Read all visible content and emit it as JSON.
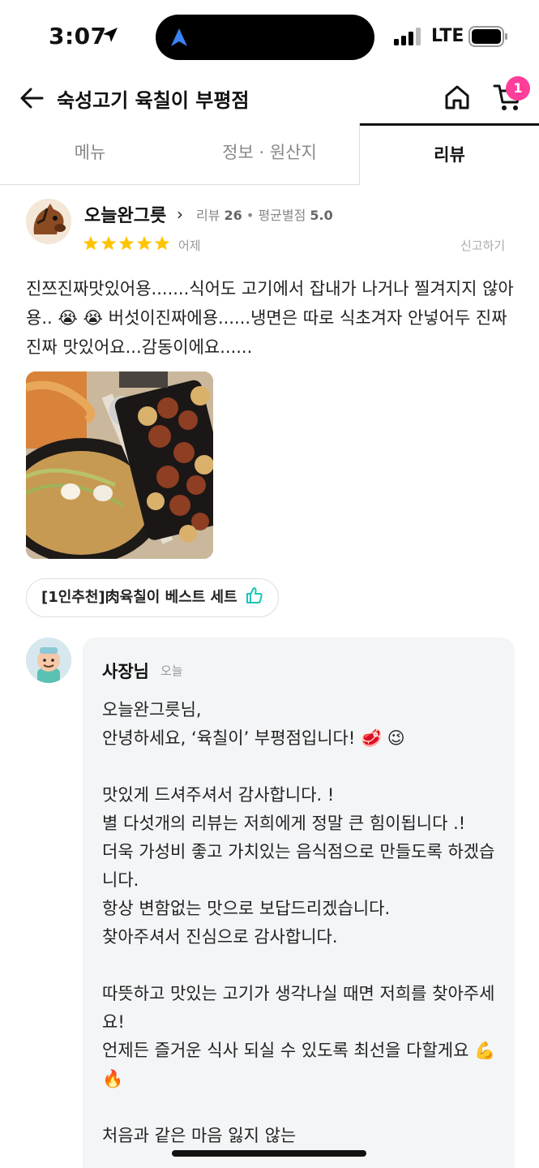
{
  "status_bar": {
    "time": "3:07",
    "network": "LTE"
  },
  "header": {
    "title": "숙성고기 육칠이 부평점",
    "cart_count": "1"
  },
  "tabs": [
    {
      "label": "메뉴"
    },
    {
      "label": "정보 · 원산지"
    },
    {
      "label": "리뷰"
    }
  ],
  "review": {
    "reviewer_name": "오늘완그릇",
    "review_count_label": "리뷰",
    "review_count": "26",
    "avg_rating_label": "평균별점",
    "avg_rating": "5.0",
    "rating": 5,
    "date": "어제",
    "report_label": "신고하기",
    "text": "진쯔진짜맛있어용.......식어도 고기에서 잡내가 나거나 찔겨지지 않아용.. 😭 😭 버섯이진짜에용......냉면은 따로 식초겨자 안넣어두 진짜진짜 맛있어요...감동이에요......",
    "menu_tag": "[1인추천]肉육칠이 베스트 세트"
  },
  "owner_reply": {
    "name": "사장님",
    "date": "오늘",
    "text": "오늘완그릇님,\n안녕하세요, ‘육칠이’ 부평점입니다! 🥩 😉\n\n맛있게 드셔주셔서 감사합니다. !\n별 다섯개의 리뷰는 저희에게 정말 큰 힘이됩니다 .!\n더욱 가성비 좋고 가치있는 음식점으로 만들도록 하겠습니다.\n항상 변함없는 맛으로 보답드리겠습니다.\n찾아주셔서 진심으로 감사합니다.\n\n따뜻하고 맛있는 고기가 생각나실 때면 저희를 찾아주세요!\n언제든 즐거운 식사 되실 수 있도록 최선을 다할게요 💪 🔥\n\n처음과 같은 마음 잃지 않는"
  },
  "colors": {
    "star": "#ffc400",
    "badge": "#ff3d9a",
    "thumb": "#19c4b4"
  }
}
